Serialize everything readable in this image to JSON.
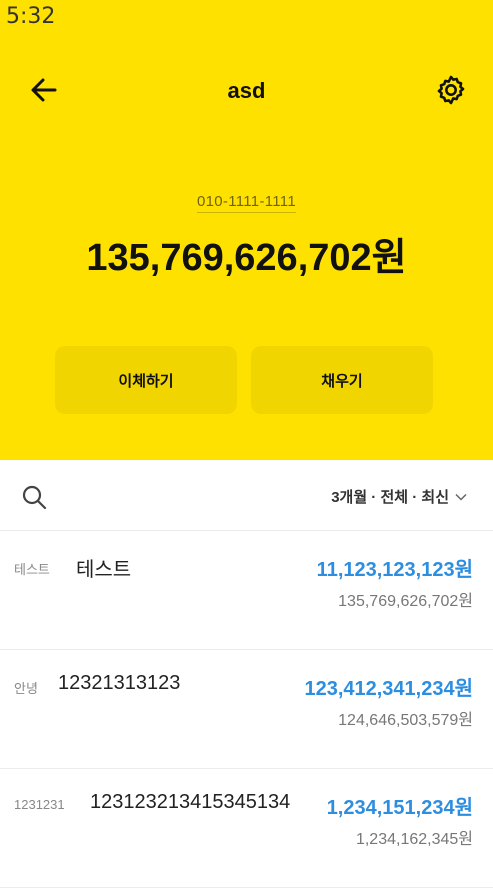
{
  "status": {
    "time": "5:32"
  },
  "header": {
    "title": "asd"
  },
  "account": {
    "number": "010-1111-1111",
    "balance": "135,769,626,702원"
  },
  "actions": {
    "transfer": "이체하기",
    "fill": "채우기"
  },
  "filter": {
    "label": "3개월 · 전체 · 최신"
  },
  "transactions": [
    {
      "category": "테스트",
      "name": "테스트",
      "amount": "11,123,123,123원",
      "balance": "135,769,626,702원"
    },
    {
      "category": "안녕",
      "name": "12321313123",
      "amount": "123,412,341,234원",
      "balance": "124,646,503,579원"
    },
    {
      "category": "1231231",
      "name": "123123213415345134",
      "amount": "1,234,151,234원",
      "balance": "1,234,162,345원"
    }
  ],
  "colors": {
    "header_bg": "#FFE100",
    "button_bg": "#F1D500",
    "amount": "#2D8EE0"
  },
  "icons": {
    "back": "arrow-left-icon",
    "settings": "gear-icon",
    "search": "search-icon",
    "filter": "chevron-down-icon"
  }
}
